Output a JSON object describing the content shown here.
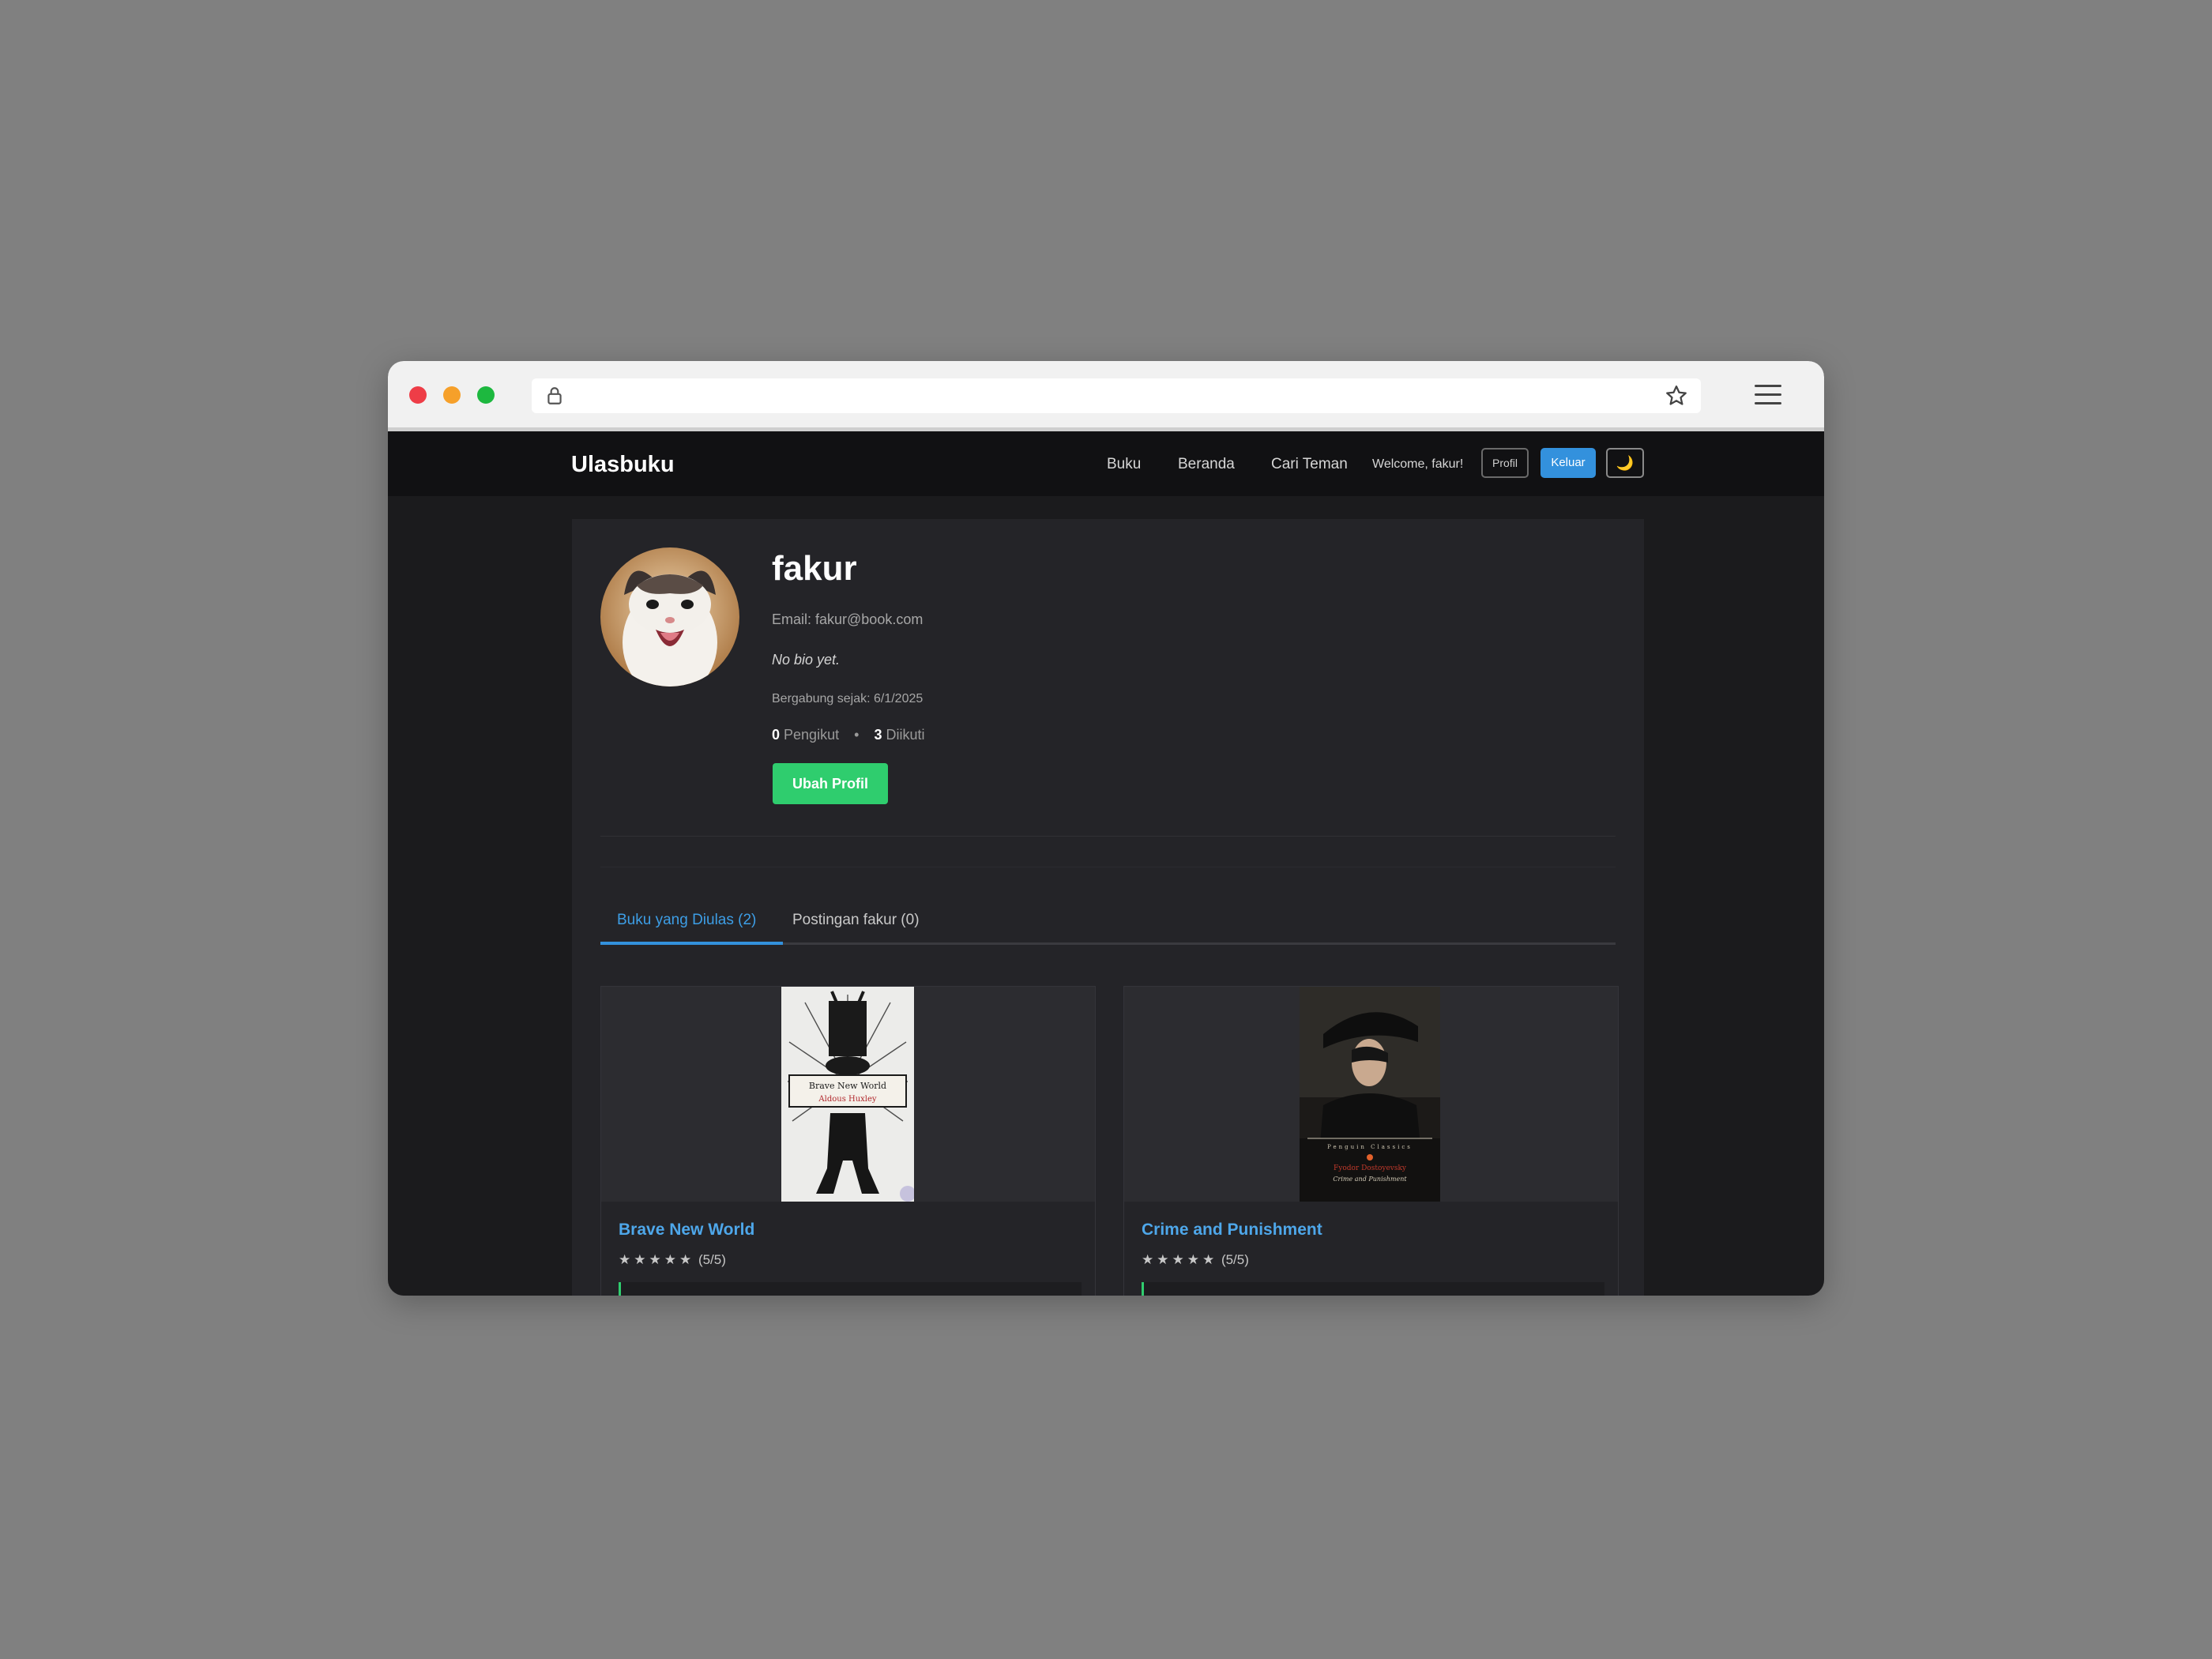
{
  "app": {
    "brand": "Ulasbuku",
    "nav": {
      "buku": "Buku",
      "beranda": "Beranda",
      "cari_teman": "Cari Teman",
      "welcome": "Welcome, fakur!",
      "profil": "Profil",
      "keluar": "Keluar",
      "theme_icon": "🌙"
    }
  },
  "profile": {
    "username": "fakur",
    "email": "Email: fakur@book.com",
    "bio": "No bio yet.",
    "joined": "Bergabung sejak: 6/1/2025",
    "followers_count": "0",
    "followers_label": "Pengikut",
    "separator": "•",
    "following_count": "3",
    "following_label": "Diikuti",
    "edit_button": "Ubah Profil"
  },
  "tabs": [
    {
      "label": "Buku yang Diulas (2)",
      "active": true
    },
    {
      "label": "Postingan fakur (0)",
      "active": false
    }
  ],
  "books": [
    {
      "title": "Brave New World",
      "stars": "★★★★★",
      "rating_text": "(5/5)",
      "rating": 5,
      "cover_title": "Brave New World",
      "cover_author": "Aldous Huxley"
    },
    {
      "title": "Crime and Punishment",
      "stars": "★★★★★",
      "rating_text": "(5/5)",
      "rating": 5,
      "cover_author": "Fyodor Dostoyevsky",
      "cover_title": "Crime and Punishment",
      "cover_publisher": "Penguin Classics"
    }
  ],
  "colors": {
    "accent": "#3391dd",
    "success": "#2fcd6e",
    "link": "#4ea7ea",
    "page_bg": "#1b1b1d",
    "navbar_bg": "#111113"
  }
}
